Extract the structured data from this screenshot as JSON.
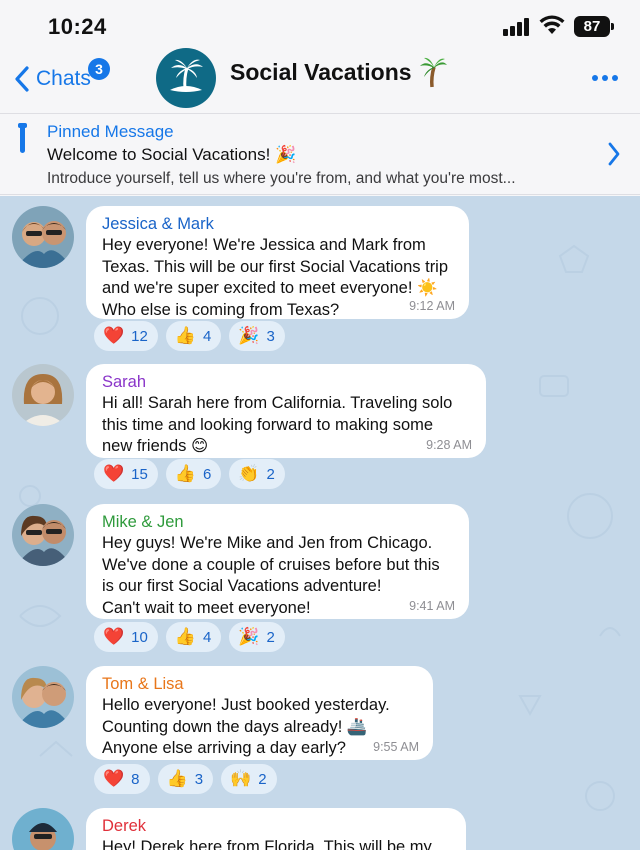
{
  "status_bar": {
    "time": "10:24",
    "battery": "87"
  },
  "header": {
    "back_label": "Chats",
    "unread_count": "3",
    "title": "Social Vacations",
    "title_emoji": "palm-tree-icon"
  },
  "pinned": {
    "heading": "Pinned Message",
    "line1": "Welcome to Social Vacations! 🎉",
    "line2": "Introduce yourself, tell us where you're from, and what you're most..."
  },
  "colors": {
    "accent": "#1677e8",
    "chat_background": "#c5d8e9",
    "reaction_chip": "#e3eef8"
  },
  "messages": [
    {
      "sender": "Jessica & Mark",
      "sender_color": "#1a64c8",
      "text": "Hey everyone! We're Jessica and Mark from\nTexas. This will be our first Social Vacations trip\nand we're super excited to meet everyone! ☀️\nWho else is coming from Texas?",
      "time": "9:12 AM",
      "reactions": [
        {
          "emoji": "❤️",
          "count": "12"
        },
        {
          "emoji": "👍",
          "count": "4"
        },
        {
          "emoji": "🎉",
          "count": "3"
        }
      ]
    },
    {
      "sender": "Sarah",
      "sender_color": "#8a35c9",
      "text": "Hi all! Sarah here from California. Traveling solo\nthis time and looking forward to making some\nnew friends 😊",
      "time": "9:28 AM",
      "reactions": [
        {
          "emoji": "❤️",
          "count": "15"
        },
        {
          "emoji": "👍",
          "count": "6"
        },
        {
          "emoji": "👏",
          "count": "2"
        }
      ]
    },
    {
      "sender": "Mike & Jen",
      "sender_color": "#2e9a3b",
      "text": "Hey guys! We're Mike and Jen from Chicago.\nWe've done a couple of cruises before but this\nis our first Social Vacations adventure!\nCan't wait to meet everyone!",
      "time": "9:41 AM",
      "reactions": [
        {
          "emoji": "❤️",
          "count": "10"
        },
        {
          "emoji": "👍",
          "count": "4"
        },
        {
          "emoji": "🎉",
          "count": "2"
        }
      ]
    },
    {
      "sender": "Tom & Lisa",
      "sender_color": "#e8761a",
      "text": "Hello everyone! Just booked yesterday.\nCounting down the days already! 🚢\nAnyone else arriving a day early?",
      "time": "9:55 AM",
      "reactions": [
        {
          "emoji": "❤️",
          "count": "8"
        },
        {
          "emoji": "👍",
          "count": "3"
        },
        {
          "emoji": "🙌",
          "count": "2"
        }
      ]
    },
    {
      "sender": "Derek",
      "sender_color": "#e0303a",
      "text": "Hey! Derek here from Florida. This will be my",
      "time": "",
      "reactions": []
    }
  ]
}
